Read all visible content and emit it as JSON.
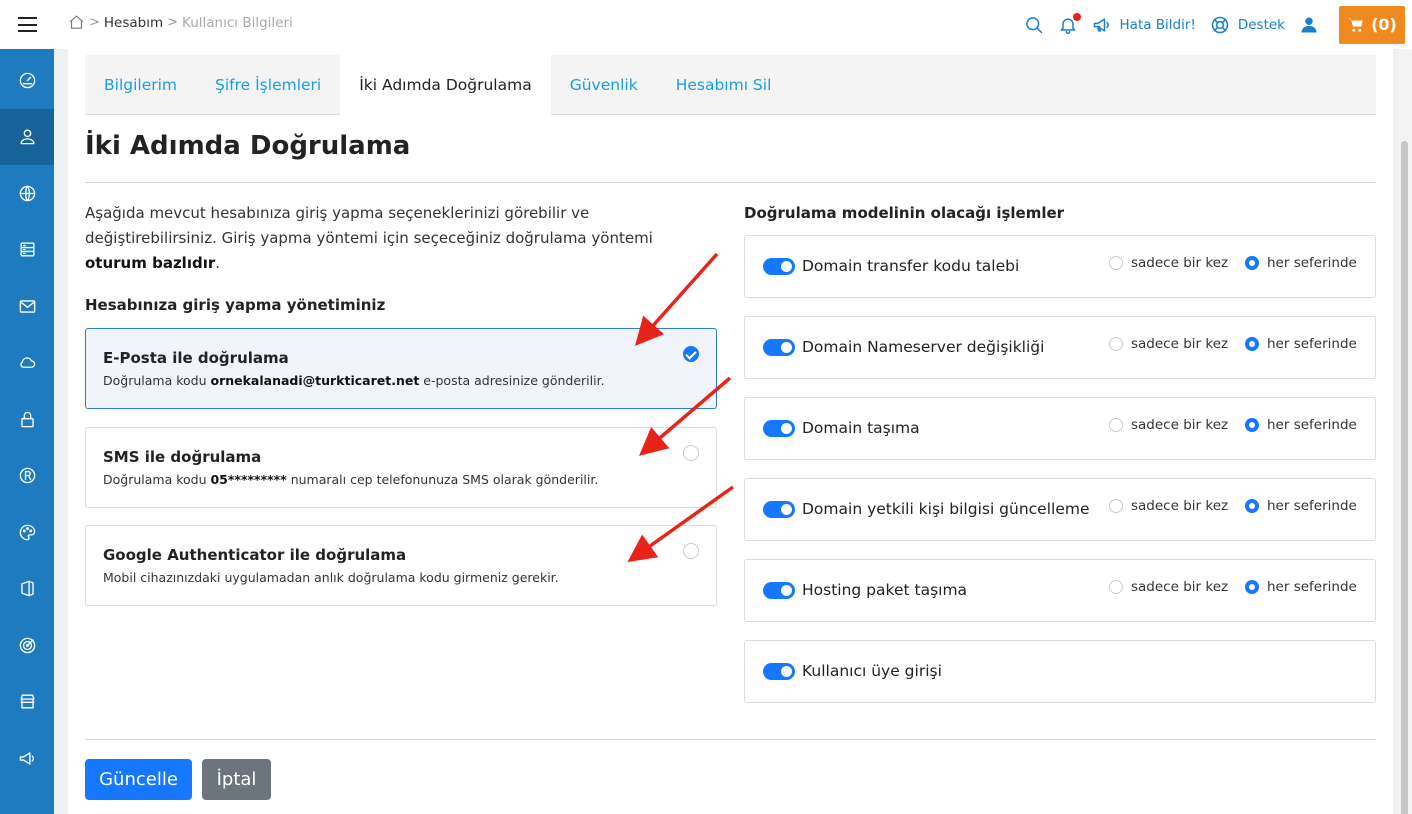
{
  "breadcrumb": {
    "home": "home-icon",
    "item1": "Hesabım",
    "item2": "Kullanıcı Bilgileri",
    "separator": ">"
  },
  "topbar": {
    "report": "Hata Bildir!",
    "support": "Destek",
    "cart": "(0)"
  },
  "tabs": [
    "Bilgilerim",
    "Şifre İşlemleri",
    "İki Adımda Doğrulama",
    "Güvenlik",
    "Hesabımı Sil"
  ],
  "page_title": "İki Adımda Doğrulama",
  "intro": {
    "text": "Aşağıda mevcut hesabınıza giriş yapma seçeneklerinizi görebilir ve değiştirebilirsiniz. Giriş yapma yöntemi için seçeceğiniz doğrulama yöntemi ",
    "bold": "oturum bazlıdır",
    "end": "."
  },
  "login_heading": "Hesabınıza giriş yapma yönetiminiz",
  "options": [
    {
      "title": "E-Posta ile doğrulama",
      "pre": "Doğrulama kodu ",
      "bold": "ornekalanadi@turkticaret.net",
      "post": " e-posta adresinize gönderilir.",
      "selected": true
    },
    {
      "title": "SMS ile doğrulama",
      "pre": "Doğrulama kodu ",
      "bold": "05*********",
      "post": " numaralı cep telefonunuza SMS olarak gönderilir.",
      "selected": false
    },
    {
      "title": "Google Authenticator ile doğrulama",
      "pre": "Mobil cihazınızdaki uygulamadan anlık doğrulama kodu girmeniz gerekir.",
      "bold": "",
      "post": "",
      "selected": false
    }
  ],
  "ops_heading": "Doğrulama modelinin olacağı işlemler",
  "freq_once": "sadece bir kez",
  "freq_every": "her seferinde",
  "operations": [
    {
      "label": "Domain transfer kodu talebi",
      "enabled": true,
      "frequency": "every"
    },
    {
      "label": "Domain Nameserver değişikliği",
      "enabled": true,
      "frequency": "every"
    },
    {
      "label": "Domain taşıma",
      "enabled": true,
      "frequency": "every"
    },
    {
      "label": "Domain yetkili kişi bilgisi güncelleme",
      "enabled": true,
      "frequency": "every"
    },
    {
      "label": "Hosting paket taşıma",
      "enabled": true,
      "frequency": "every"
    },
    {
      "label": "Kullanıcı üye girişi",
      "enabled": true,
      "frequency": ""
    }
  ],
  "buttons": {
    "update": "Güncelle",
    "cancel": "İptal"
  },
  "colors": {
    "primary": "#1677ff",
    "sidebar": "#1f7bbf",
    "cart": "#f08a1f",
    "arrow": "#e8231a"
  }
}
